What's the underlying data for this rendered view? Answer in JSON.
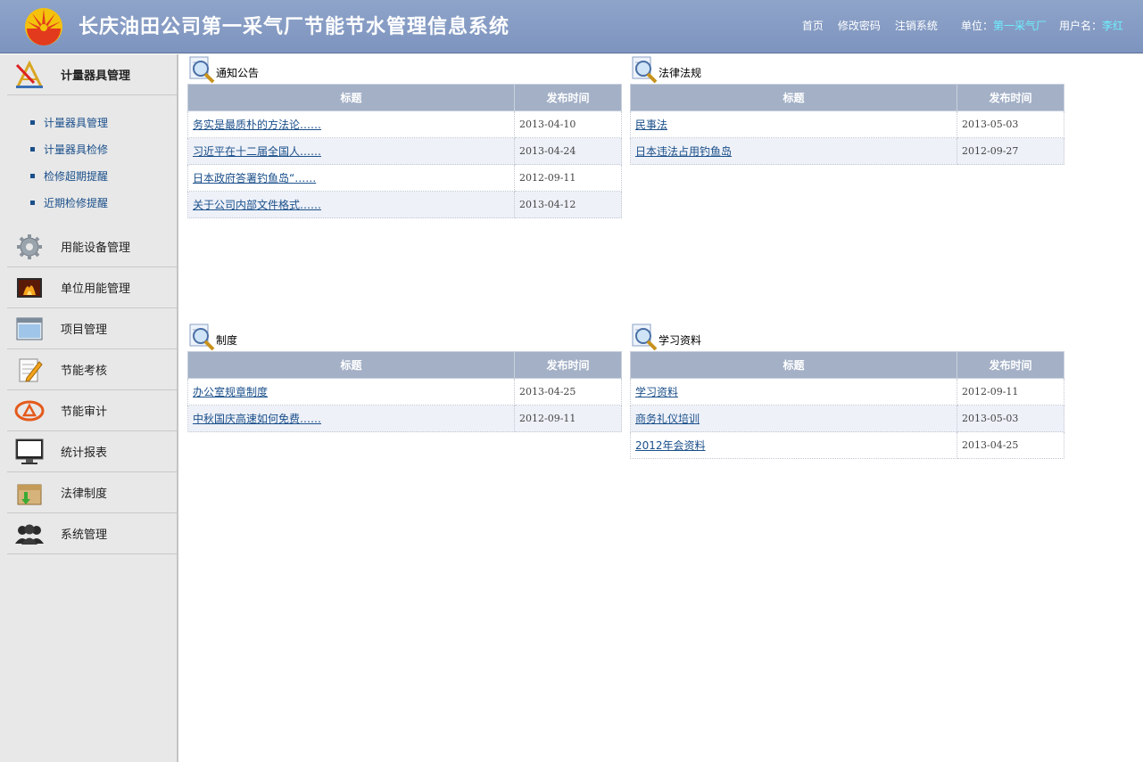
{
  "header": {
    "title": "长庆油田公司第一采气厂节能节水管理信息系统",
    "nav": {
      "home": "首页",
      "change_password": "修改密码",
      "logout": "注销系统"
    },
    "unit_label": "单位：",
    "unit_value": "第一采气厂",
    "user_label": "用户名：",
    "user_value": "李红"
  },
  "sidebar": {
    "active_menu": "计量器具管理",
    "sub_items": [
      "计量器具管理",
      "计量器具检修",
      "检修超期提醒",
      "近期检修提醒"
    ],
    "menus": [
      {
        "label": "用能设备管理",
        "icon": "gear-icon"
      },
      {
        "label": "单位用能管理",
        "icon": "fire-monitor-icon"
      },
      {
        "label": "项目管理",
        "icon": "window-icon"
      },
      {
        "label": "节能考核",
        "icon": "notepad-pencil-icon"
      },
      {
        "label": "节能审计",
        "icon": "company-logo-icon"
      },
      {
        "label": "统计报表",
        "icon": "monitor-icon"
      },
      {
        "label": "法律制度",
        "icon": "box-arrow-icon"
      },
      {
        "label": "系统管理",
        "icon": "users-icon"
      }
    ]
  },
  "table_headers": {
    "title": "标题",
    "date": "发布时间"
  },
  "panels": {
    "notices": {
      "title": "通知公告",
      "rows": [
        {
          "title": "务实是最质朴的方法论……",
          "date": "2013-04-10"
        },
        {
          "title": "习近平在十二届全国人……",
          "date": "2013-04-24"
        },
        {
          "title": "日本政府答署钓鱼岛“……",
          "date": "2012-09-11"
        },
        {
          "title": "关于公司内部文件格式……",
          "date": "2013-04-12"
        }
      ]
    },
    "laws": {
      "title": "法律法规",
      "rows": [
        {
          "title": "民事法",
          "date": "2013-05-03"
        },
        {
          "title": "日本违法占用钓鱼岛",
          "date": "2012-09-27"
        }
      ]
    },
    "rules": {
      "title": "制度",
      "rows": [
        {
          "title": "办公室规章制度",
          "date": "2013-04-25"
        },
        {
          "title": "中秋国庆高速如何免费……",
          "date": "2012-09-11"
        }
      ]
    },
    "study": {
      "title": "学习资料",
      "rows": [
        {
          "title": "学习资料",
          "date": "2012-09-11"
        },
        {
          "title": "商务礼仪培训",
          "date": "2013-05-03"
        },
        {
          "title": "2012年会资料",
          "date": "2013-04-25"
        }
      ]
    }
  }
}
